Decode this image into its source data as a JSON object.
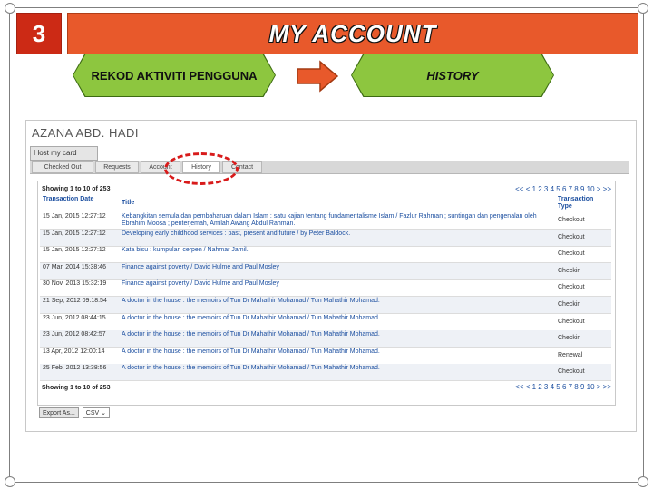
{
  "slide": {
    "number": "3",
    "title": "MY ACCOUNT",
    "step_left": "REKOD AKTIVITI PENGGUNA",
    "step_right": "HISTORY"
  },
  "account": {
    "name": "AZANA ABD. HADI",
    "lost_card": "I lost my card",
    "tabs": [
      "Checked Out",
      "Requests",
      "Account",
      "History",
      "Contact"
    ],
    "active_tab": "History",
    "showing": "Showing 1 to 10 of 253",
    "pager": "<< < 1 2 3 4 5 6 7 8 9 10 > >>",
    "columns": {
      "date": "Transaction Date",
      "title": "Title",
      "type": "Transaction Type"
    },
    "rows": [
      {
        "date": "15 Jan, 2015 12:27:12",
        "title": "Kebangkitan semula dan pembaharuan dalam Islam : satu kajian tentang fundamentalisme Islam / Fazlur Rahman ; suntingan dan pengenalan oleh Ebrahim Moosa ; penterjemah, Amilah Awang Abdul Rahman.",
        "type": "Checkout"
      },
      {
        "date": "15 Jan, 2015 12:27:12",
        "title": "Developing early childhood services : past, present and future / by Peter Baldock.",
        "type": "Checkout"
      },
      {
        "date": "15 Jan, 2015 12:27:12",
        "title": "Kata bisu : kumpulan cerpen / Nahmar Jamil.",
        "type": "Checkout"
      },
      {
        "date": "07 Mar, 2014 15:38:46",
        "title": "Finance against poverty / David Hulme and Paul Mosley",
        "type": "Checkin"
      },
      {
        "date": "30 Nov, 2013 15:32:19",
        "title": "Finance against poverty / David Hulme and Paul Mosley",
        "type": "Checkout"
      },
      {
        "date": "21 Sep, 2012 09:18:54",
        "title": "A doctor in the house : the memoirs of Tun Dr Mahathir Mohamad / Tun Mahathir Mohamad.",
        "type": "Checkin"
      },
      {
        "date": "23 Jun, 2012 08:44:15",
        "title": "A doctor in the house : the memoirs of Tun Dr Mahathir Mohamad / Tun Mahathir Mohamad.",
        "type": "Checkout"
      },
      {
        "date": "23 Jun, 2012 08:42:57",
        "title": "A doctor in the house : the memoirs of Tun Dr Mahathir Mohamad / Tun Mahathir Mohamad.",
        "type": "Checkin"
      },
      {
        "date": "13 Apr, 2012 12:00:14",
        "title": "A doctor in the house : the memoirs of Tun Dr Mahathir Mohamad / Tun Mahathir Mohamad.",
        "type": "Renewal"
      },
      {
        "date": "25 Feb, 2012 13:38:56",
        "title": "A doctor in the house : the memoirs of Tun Dr Mahathir Mohamad / Tun Mahathir Mohamad.",
        "type": "Checkout"
      }
    ],
    "export_label": "Export As...",
    "export_format": "CSV"
  },
  "colors": {
    "number_box": "#cc2a15",
    "title_bar": "#e8592b",
    "step_green": "#8dc63f",
    "arrow": "#e8592b",
    "link_blue": "#1c4fa0",
    "highlight_ring": "#d81b1b"
  }
}
